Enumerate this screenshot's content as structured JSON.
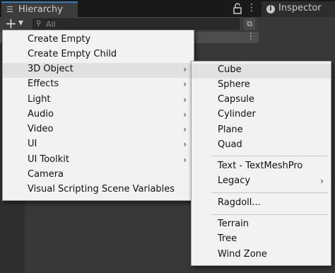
{
  "hierarchy": {
    "tab_label": "Hierarchy",
    "search_placeholder": "All"
  },
  "inspector": {
    "tab_label": "Inspector"
  },
  "create_menu": {
    "items": [
      {
        "label": "Create Empty",
        "submenu": false
      },
      {
        "label": "Create Empty Child",
        "submenu": false
      },
      {
        "label": "3D Object",
        "submenu": true,
        "highlighted": true
      },
      {
        "label": "Effects",
        "submenu": true
      },
      {
        "label": "Light",
        "submenu": true
      },
      {
        "label": "Audio",
        "submenu": true
      },
      {
        "label": "Video",
        "submenu": true
      },
      {
        "label": "UI",
        "submenu": true
      },
      {
        "label": "UI Toolkit",
        "submenu": true
      },
      {
        "label": "Camera",
        "submenu": false
      },
      {
        "label": "Visual Scripting Scene Variables",
        "submenu": false
      }
    ]
  },
  "object_submenu": {
    "items": [
      {
        "label": "Cube",
        "highlighted": true
      },
      {
        "label": "Sphere"
      },
      {
        "label": "Capsule"
      },
      {
        "label": "Cylinder"
      },
      {
        "label": "Plane"
      },
      {
        "label": "Quad"
      },
      {
        "label": "Text - TextMeshPro"
      },
      {
        "label": "Legacy",
        "submenu": true
      },
      {
        "label": "Ragdoll..."
      },
      {
        "label": "Terrain"
      },
      {
        "label": "Tree"
      },
      {
        "label": "Wind Zone"
      }
    ]
  },
  "icons": {
    "hierarchy_tab": "list-icon",
    "lock": "lock-icon",
    "panel_menu": "kebab-menu-icon",
    "add": "plus-icon",
    "search": "search-icon",
    "scene_search": "scene-search-icon",
    "inspector_tab": "info-icon",
    "submenu_arrow": "chevron-right-icon"
  },
  "colors": {
    "panel_bg": "#383838",
    "active_tab_accent": "#3a79bb",
    "menu_bg": "#f2f2f2",
    "menu_highlight": "#e1e1e1"
  }
}
